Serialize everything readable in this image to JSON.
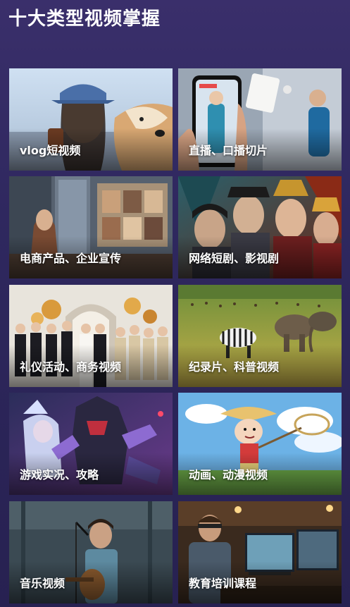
{
  "header": {
    "title": "十大类型视频掌握"
  },
  "cards": [
    {
      "label": "vlog短视频"
    },
    {
      "label": "直播、口播切片"
    },
    {
      "label": "电商产品、企业宣传"
    },
    {
      "label": "网络短剧、影视剧"
    },
    {
      "label": "礼仪活动、商务视频"
    },
    {
      "label": "纪录片、科普视频"
    },
    {
      "label": "游戏实况、攻略"
    },
    {
      "label": "动画、动漫视频"
    },
    {
      "label": "音乐视频"
    },
    {
      "label": "教育培训课程"
    }
  ]
}
